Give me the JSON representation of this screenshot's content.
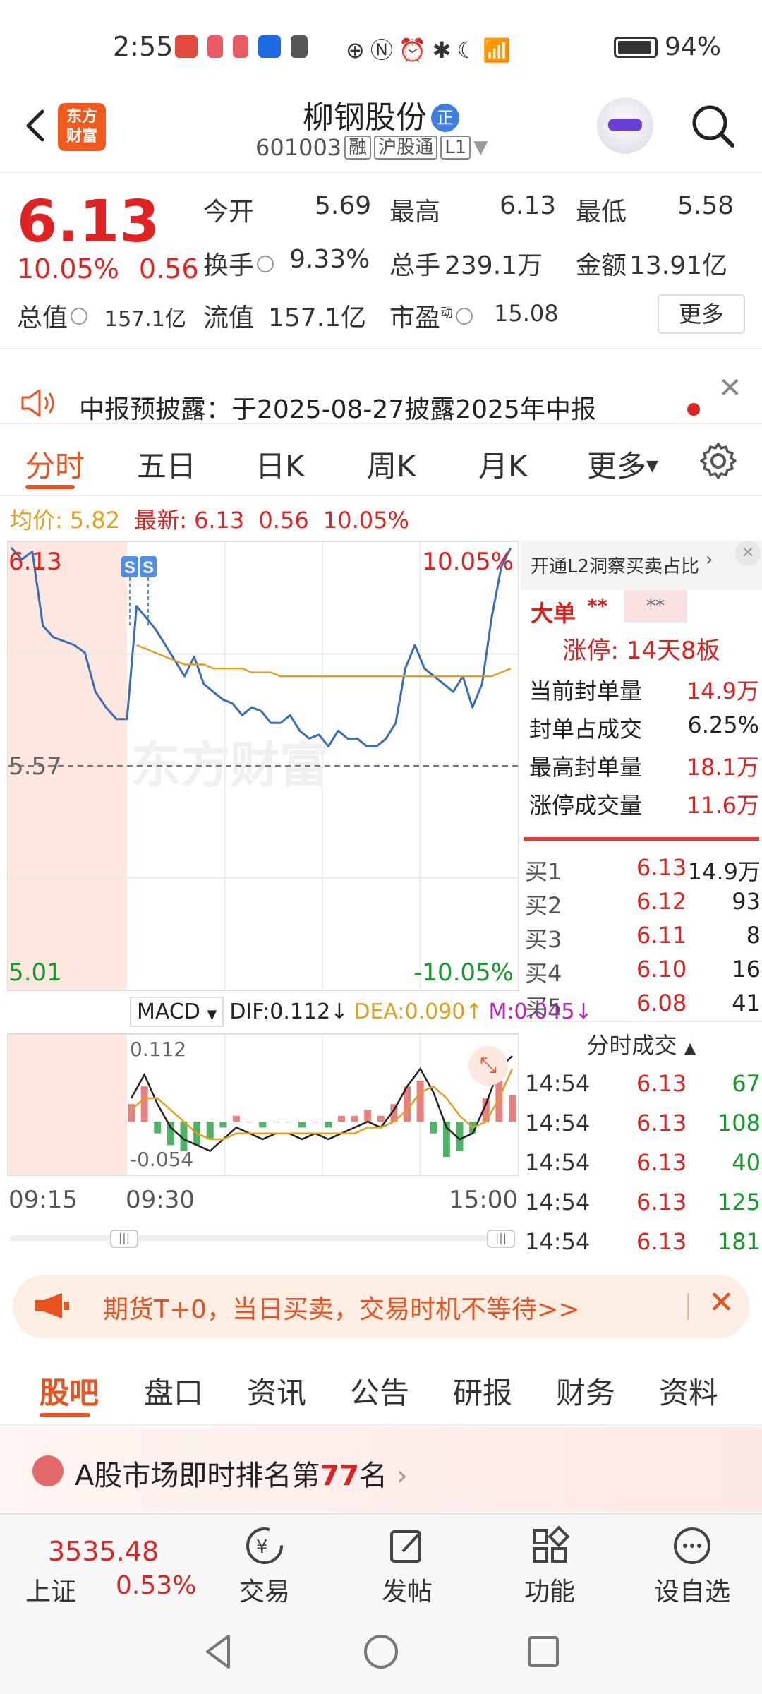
{
  "status_bar": {
    "time": "2:55",
    "battery": "94%",
    "battery_level": 0.94
  },
  "header": {
    "stock_name": "柳钢股份",
    "badge": "正",
    "code": "601003",
    "tags": [
      "融",
      "沪股通",
      "L1"
    ],
    "logo_text": "东方\n财富"
  },
  "quote": {
    "price": "6.13",
    "change_pct": "10.05%",
    "change": "0.56",
    "open_label": "今开",
    "open": "5.69",
    "high_label": "最高",
    "high": "6.13",
    "low_label": "最低",
    "low": "5.58",
    "turnover_label": "换手",
    "turnover": "9.33%",
    "volume_label": "总手",
    "volume": "239.1万",
    "amount_label": "金额",
    "amount": "13.91亿",
    "mktcap_label": "总值",
    "mktcap": "157.1亿",
    "float_label": "流值",
    "float": "157.1亿",
    "pe_label": "市盈",
    "pe_sup": "动",
    "pe": "15.08",
    "more_label": "更多"
  },
  "notice": {
    "text": "中报预披露：于2025-08-27披露2025年中报"
  },
  "chart_tabs": {
    "items": [
      "分时",
      "五日",
      "日K",
      "周K",
      "月K",
      "更多"
    ],
    "active": "分时"
  },
  "info_line": {
    "avg_label": "均价:",
    "avg": "5.82",
    "latest_label": "最新:",
    "latest": "6.13",
    "change": "0.56",
    "pct": "10.05%"
  },
  "chart_data": {
    "type": "line",
    "title": "",
    "ylim": [
      5.01,
      6.13
    ],
    "y_ref": 5.57,
    "top_left": "6.13",
    "top_right": "10.05%",
    "ref_label": "5.57",
    "bottom_left": "5.01",
    "bottom_right": "-10.05%",
    "markers": [
      "S",
      "S"
    ],
    "watermark": "东方财富",
    "x_labels": [
      "09:15",
      "09:30",
      "15:00"
    ],
    "series": [
      {
        "color": "#3a6db5",
        "values": [
          6.13,
          6.1,
          6.12,
          5.93,
          5.9,
          5.89,
          5.88,
          5.86,
          5.76,
          5.72,
          5.69,
          5.69,
          5.98,
          5.95,
          5.92,
          5.88,
          5.84,
          5.8,
          5.85,
          5.78,
          5.76,
          5.74,
          5.73,
          5.7,
          5.72,
          5.71,
          5.68,
          5.68,
          5.7,
          5.66,
          5.64,
          5.65,
          5.62,
          5.66,
          5.64,
          5.64,
          5.62,
          5.62,
          5.64,
          5.68,
          5.82,
          5.88,
          5.82,
          5.8,
          5.78,
          5.76,
          5.8,
          5.72,
          5.78,
          5.95,
          6.08,
          6.13
        ]
      },
      {
        "color": "#e0a21d",
        "values": [
          null,
          null,
          null,
          null,
          null,
          null,
          null,
          null,
          null,
          null,
          null,
          null,
          5.88,
          5.87,
          5.86,
          5.85,
          5.84,
          5.83,
          5.83,
          5.83,
          5.82,
          5.82,
          5.82,
          5.82,
          5.81,
          5.81,
          5.81,
          5.8,
          5.8,
          5.8,
          5.8,
          5.8,
          5.8,
          5.8,
          5.8,
          5.8,
          5.8,
          5.8,
          5.8,
          5.8,
          5.8,
          5.8,
          5.8,
          5.8,
          5.8,
          5.8,
          5.8,
          5.8,
          5.8,
          5.8,
          5.81,
          5.82
        ]
      }
    ]
  },
  "macd": {
    "name": "MACD",
    "dif_label": "DIF:0.112↓",
    "dea_label": "DEA:0.090↑",
    "m_label": "M:0.045↓",
    "top": "0.112",
    "bottom": "-0.054",
    "dif": [
      0.04,
      0.08,
      0.03,
      -0.01,
      -0.03,
      -0.04,
      -0.05,
      -0.03,
      -0.01,
      -0.02,
      -0.03,
      -0.02,
      -0.02,
      -0.03,
      -0.02,
      -0.03,
      -0.02,
      -0.01,
      0.0,
      -0.01,
      0.02,
      0.06,
      0.09,
      0.05,
      -0.01,
      -0.03,
      -0.02,
      0.03,
      0.09,
      0.112
    ],
    "dea": [
      0.02,
      0.04,
      0.04,
      0.02,
      0.0,
      -0.02,
      -0.03,
      -0.03,
      -0.02,
      -0.02,
      -0.02,
      -0.02,
      -0.02,
      -0.02,
      -0.02,
      -0.02,
      -0.02,
      -0.02,
      -0.01,
      -0.01,
      0.0,
      0.02,
      0.05,
      0.06,
      0.04,
      0.01,
      -0.01,
      0.0,
      0.04,
      0.09
    ],
    "hist": [
      0.03,
      0.06,
      -0.02,
      -0.04,
      -0.05,
      -0.04,
      -0.03,
      -0.01,
      0.01,
      0.0,
      -0.01,
      0.0,
      0.0,
      -0.01,
      0.0,
      -0.01,
      0.01,
      0.01,
      0.02,
      0.01,
      0.03,
      0.06,
      0.07,
      -0.02,
      -0.06,
      -0.05,
      -0.02,
      0.04,
      0.07,
      0.045
    ]
  },
  "right_panel": {
    "banner": "开通L2洞察买卖占比",
    "big_order_label": "大单",
    "big_order_mask": "**",
    "big_order_mask2": "**",
    "limit_label": "涨停:",
    "limit_value": "14天8板",
    "rows": [
      {
        "label": "当前封单量",
        "value": "14.9万"
      },
      {
        "label": "封单占成交",
        "value": "6.25%"
      },
      {
        "label": "最高封单量",
        "value": "18.1万"
      },
      {
        "label": "涨停成交量",
        "value": "11.6万"
      }
    ],
    "orderbook": [
      {
        "label": "买1",
        "price": "6.13",
        "vol": "14.9万"
      },
      {
        "label": "买2",
        "price": "6.12",
        "vol": "93"
      },
      {
        "label": "买3",
        "price": "6.11",
        "vol": "8"
      },
      {
        "label": "买4",
        "price": "6.10",
        "vol": "16"
      },
      {
        "label": "买5",
        "price": "6.08",
        "vol": "41"
      }
    ],
    "trades_title": "分时成交",
    "trades": [
      {
        "time": "14:54",
        "price": "6.13",
        "vol": "67"
      },
      {
        "time": "14:54",
        "price": "6.13",
        "vol": "108"
      },
      {
        "time": "14:54",
        "price": "6.13",
        "vol": "40"
      },
      {
        "time": "14:54",
        "price": "6.13",
        "vol": "125"
      },
      {
        "time": "14:54",
        "price": "6.13",
        "vol": "181"
      }
    ]
  },
  "futures_banner": {
    "text": "期货T+0，当日买卖，交易时机不等待>>"
  },
  "content_tabs": {
    "items": [
      "股吧",
      "盘口",
      "资讯",
      "公告",
      "研报",
      "财务",
      "资料"
    ],
    "active": "股吧"
  },
  "rank_card": {
    "prefix": "A股市场即时排名第",
    "rank": "77",
    "suffix": "名"
  },
  "bottom_nav": {
    "index_value": "3535.48",
    "index_name": "上证",
    "index_pct": "0.53%",
    "items": [
      "交易",
      "发帖",
      "功能",
      "设自选"
    ]
  }
}
